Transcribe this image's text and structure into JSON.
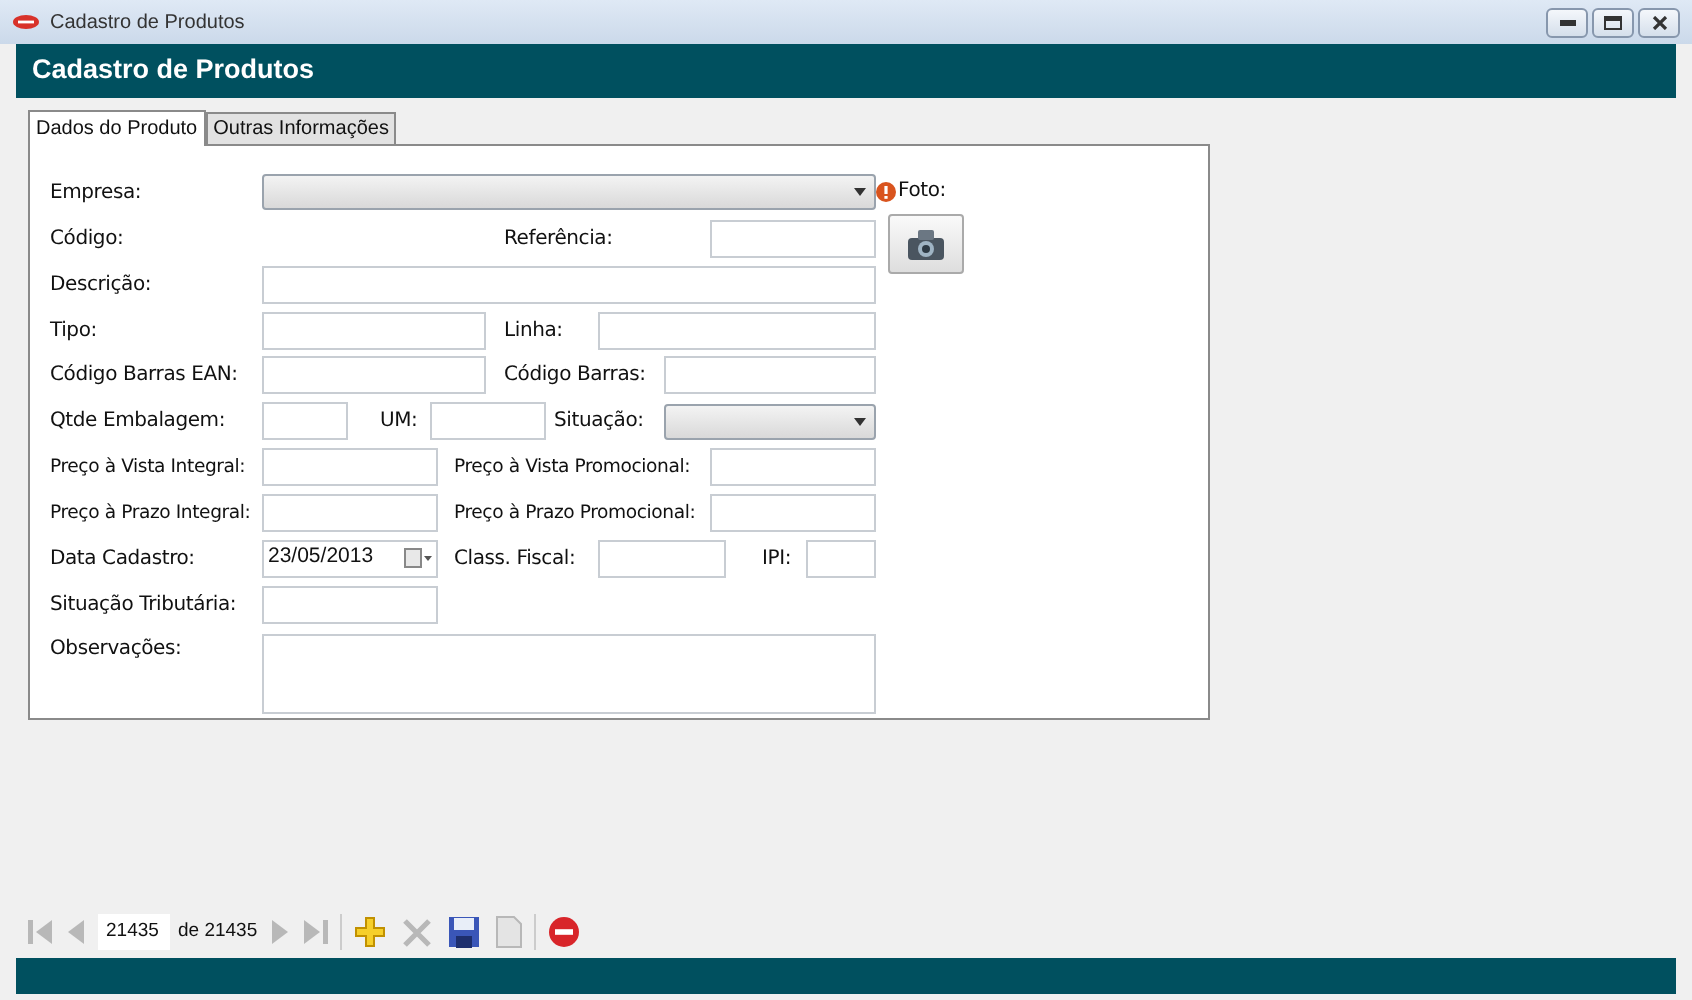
{
  "window": {
    "title": "Cadastro de Produtos"
  },
  "header": {
    "title": "Cadastro de Produtos"
  },
  "tabs": [
    {
      "label": "Dados do Produto",
      "selected": true
    },
    {
      "label": "Outras Informações",
      "selected": false
    }
  ],
  "form": {
    "lines": [
      {
        "fields": [
          {
            "label": "Empresa:",
            "kind": "select"
          }
        ]
      },
      {
        "fields": [
          {
            "label": "Código:",
            "kind": "none"
          },
          {
            "label": "Referência:",
            "kind": "input"
          }
        ]
      },
      {
        "fields": [
          {
            "label": "Descrição:",
            "kind": "input"
          }
        ]
      },
      {
        "fields": [
          {
            "label": "Tipo:",
            "kind": "input"
          },
          {
            "label": "Linha:",
            "kind": "input"
          }
        ]
      },
      {
        "fields": [
          {
            "label": "Código Barras EAN:",
            "kind": "input"
          },
          {
            "label": "Código Barras:",
            "kind": "input"
          }
        ]
      },
      {
        "fields": [
          {
            "label": "Qtde Embalagem:",
            "kind": "input"
          },
          {
            "label": "UM:",
            "kind": "input"
          },
          {
            "label": "Situação:",
            "kind": "select"
          }
        ]
      },
      {
        "fields": [
          {
            "label": "Preço à Vista Integral:",
            "kind": "input"
          },
          {
            "label": "Preço à Vista Promocional:",
            "kind": "input"
          }
        ]
      },
      {
        "fields": [
          {
            "label": "Preço à Prazo Integral:",
            "kind": "input"
          },
          {
            "label": "Preço à Prazo Promocional:",
            "kind": "input"
          }
        ]
      },
      {
        "fields": [
          {
            "label": "Data Cadastro:",
            "kind": "date",
            "value": "23/05/2013"
          },
          {
            "label": "Class. Fiscal:",
            "kind": "input"
          },
          {
            "label": "IPI:",
            "kind": "input"
          }
        ]
      },
      {
        "fields": [
          {
            "label": "Situação Tributária:",
            "kind": "input"
          }
        ]
      },
      {
        "fields": [
          {
            "label": "Observações:",
            "kind": "textarea"
          }
        ]
      }
    ],
    "photo": {
      "label": "Foto:",
      "warning": true
    }
  },
  "navigator": {
    "record": "21435",
    "total": "de 21435",
    "buttons": [
      {
        "kind": "first",
        "disabled": true
      },
      {
        "kind": "prev",
        "disabled": true
      },
      {
        "kind": "record"
      },
      {
        "kind": "next",
        "disabled": true
      },
      {
        "kind": "last",
        "disabled": true
      },
      {
        "kind": "sep"
      },
      {
        "kind": "add",
        "disabled": false
      },
      {
        "kind": "delete",
        "disabled": true
      },
      {
        "kind": "save",
        "disabled": false
      },
      {
        "kind": "copy",
        "disabled": true
      },
      {
        "kind": "sep"
      },
      {
        "kind": "cancel",
        "disabled": false
      }
    ]
  }
}
